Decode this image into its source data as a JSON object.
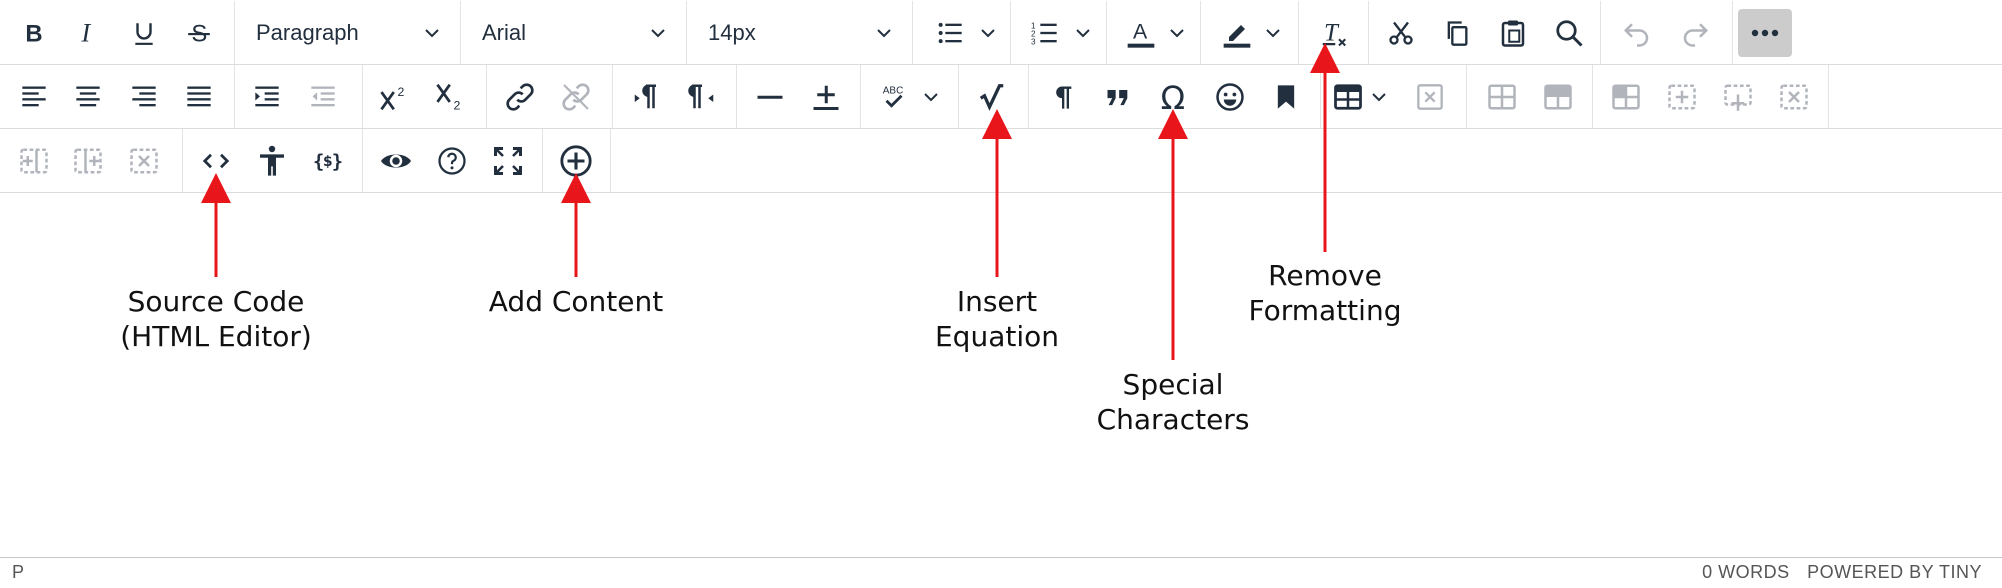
{
  "toolbar": {
    "block_format": "Paragraph",
    "font_family": "Arial",
    "font_size": "14px"
  },
  "status": {
    "path": "P",
    "word_count": "0 WORDS",
    "branding": "POWERED BY TINY"
  },
  "callouts": {
    "source_code": [
      "Source Code",
      "(HTML Editor)"
    ],
    "add_content": [
      "Add Content"
    ],
    "insert_equation": [
      "Insert",
      "Equation"
    ],
    "special_characters": [
      "Special",
      "Characters"
    ],
    "remove_formatting": [
      "Remove",
      "Formatting"
    ]
  },
  "colors": {
    "icon": "#222f3e",
    "annotation_arrow": "#e8161b",
    "more_button_bg": "#cccccc"
  },
  "icons": [
    "bold-icon",
    "italic-icon",
    "underline-icon",
    "strikethrough-icon",
    "bullet-list-icon",
    "numbered-list-icon",
    "text-color-icon",
    "highlight-icon",
    "remove-format-icon",
    "cut-icon",
    "copy-icon",
    "paste-icon",
    "search-icon",
    "undo-icon",
    "redo-icon",
    "more-icon",
    "align-left-icon",
    "align-center-icon",
    "align-right-icon",
    "justify-icon",
    "indent-icon",
    "outdent-icon",
    "superscript-icon",
    "subscript-icon",
    "link-icon",
    "unlink-icon",
    "ltr-icon",
    "rtl-icon",
    "horizontal-rule-icon",
    "embed-icon",
    "spellcheck-icon",
    "equation-icon",
    "pilcrow-icon",
    "blockquote-icon",
    "omega-icon",
    "emoji-icon",
    "bookmark-icon",
    "table-icon",
    "delete-table-icon",
    "code-icon",
    "accessibility-icon",
    "lti-tool-icon",
    "preview-icon",
    "help-icon",
    "fullscreen-icon",
    "add-content-icon"
  ]
}
